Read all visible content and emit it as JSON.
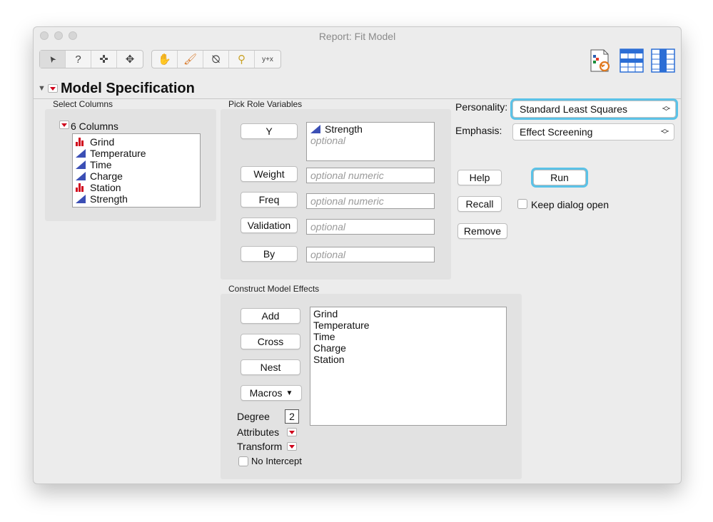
{
  "window": {
    "title": "Report: Fit Model"
  },
  "toolbar": {
    "tools": [
      {
        "name": "arrow-tool-icon",
        "glyph": "➤"
      },
      {
        "name": "help-tool-icon",
        "glyph": "?"
      },
      {
        "name": "crosshair-tool-icon",
        "glyph": "✜"
      },
      {
        "name": "move-tool-icon",
        "glyph": "✥"
      },
      {
        "name": "hand-tool-icon",
        "glyph": "✋"
      },
      {
        "name": "brush-tool-icon",
        "glyph": "🖌"
      },
      {
        "name": "lasso-tool-icon",
        "glyph": "⦰"
      },
      {
        "name": "magnifier-tool-icon",
        "glyph": "⚲"
      },
      {
        "name": "annotate-tool-icon",
        "glyph": "y+x"
      }
    ]
  },
  "section": {
    "title": "Model Specification"
  },
  "select_columns": {
    "label": "Select Columns",
    "count_label": "6 Columns",
    "columns": [
      {
        "name": "Grind",
        "type": "nominal"
      },
      {
        "name": "Temperature",
        "type": "continuous"
      },
      {
        "name": "Time",
        "type": "continuous"
      },
      {
        "name": "Charge",
        "type": "continuous"
      },
      {
        "name": "Station",
        "type": "nominal"
      },
      {
        "name": "Strength",
        "type": "continuous"
      }
    ]
  },
  "roles": {
    "label": "Pick Role Variables",
    "y": {
      "button": "Y",
      "value": "Strength",
      "placeholder": "optional"
    },
    "weight": {
      "button": "Weight",
      "placeholder": "optional numeric"
    },
    "freq": {
      "button": "Freq",
      "placeholder": "optional numeric"
    },
    "validation": {
      "button": "Validation",
      "placeholder": "optional"
    },
    "by": {
      "button": "By",
      "placeholder": "optional"
    }
  },
  "personality": {
    "label": "Personality:",
    "value": "Standard Least Squares"
  },
  "emphasis": {
    "label": "Emphasis:",
    "value": "Effect Screening"
  },
  "actions": {
    "help": "Help",
    "run": "Run",
    "recall": "Recall",
    "remove": "Remove",
    "keep_open": "Keep dialog open"
  },
  "effects": {
    "label": "Construct Model Effects",
    "add": "Add",
    "cross": "Cross",
    "nest": "Nest",
    "macros": "Macros",
    "degree_label": "Degree",
    "degree_value": "2",
    "attributes_label": "Attributes",
    "transform_label": "Transform",
    "no_intercept": "No Intercept",
    "items": [
      "Grind",
      "Temperature",
      "Time",
      "Charge",
      "Station"
    ]
  },
  "colors": {
    "focus": "#5bc2e7",
    "red_menu": "#d0021b",
    "continuous_icon": "#3b4fb5"
  }
}
